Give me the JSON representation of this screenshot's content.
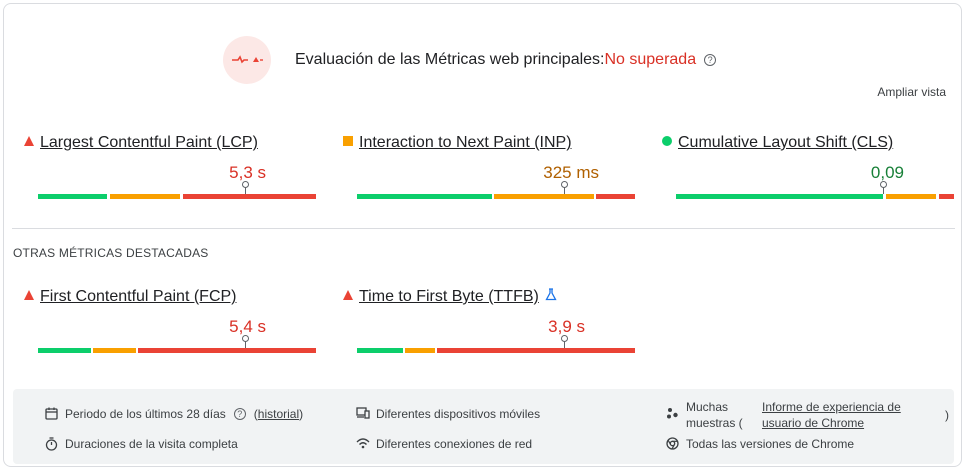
{
  "header": {
    "title": "Evaluación de las Métricas web principales:",
    "status": "No superada",
    "expand_label": "Ampliar vista"
  },
  "core_metrics": [
    {
      "name": "Largest Contentful Paint (LCP)",
      "value": "5,3 s",
      "rating": "poor",
      "value_color": "#d93025",
      "indicator": "triangle-icon",
      "distribution": [
        0.25,
        0.26,
        0.49
      ],
      "marker_fraction": 0.745
    },
    {
      "name": "Interaction to Next Paint (INP)",
      "value": "325 ms",
      "rating": "needs-improvement",
      "value_color": "#b06000",
      "indicator": "square-icon",
      "distribution": [
        0.49,
        0.37,
        0.14
      ],
      "marker_fraction": 0.745
    },
    {
      "name": "Cumulative Layout Shift (CLS)",
      "value": "0,09",
      "rating": "good",
      "value_color": "#188038",
      "indicator": "circle-icon",
      "distribution": [
        0.744,
        0.196,
        0.06
      ],
      "marker_fraction": 0.745
    }
  ],
  "section_label": "OTRAS MÉTRICAS DESTACADAS",
  "other_metrics": [
    {
      "name": "First Contentful Paint (FCP)",
      "value": "5,4 s",
      "rating": "poor",
      "value_color": "#d93025",
      "indicator": "triangle-icon",
      "distribution": [
        0.195,
        0.16,
        0.645
      ],
      "marker_fraction": 0.745,
      "experimental": false
    },
    {
      "name": "Time to First Byte (TTFB)",
      "value": "3,9 s",
      "rating": "poor",
      "value_color": "#d93025",
      "indicator": "triangle-icon",
      "distribution": [
        0.17,
        0.11,
        0.72
      ],
      "marker_fraction": 0.745,
      "experimental": true
    }
  ],
  "footer": {
    "period_label": "Periodo de los últimos 28 días",
    "period_link": "historial",
    "duration_label": "Duraciones de la visita completa",
    "devices_label": "Diferentes dispositivos móviles",
    "network_label": "Diferentes conexiones de red",
    "samples_prefix_1": "Muchas",
    "samples_prefix_2": "muestras (",
    "samples_link_1": "Informe de experiencia de",
    "samples_link_2": "usuario de Chrome",
    "samples_suffix": ")",
    "versions_label": "Todas las versiones de Chrome"
  },
  "colors": {
    "good": "#0cce6b",
    "average": "#f9a000",
    "poor": "#ea4335",
    "fail_text": "#d93025"
  }
}
